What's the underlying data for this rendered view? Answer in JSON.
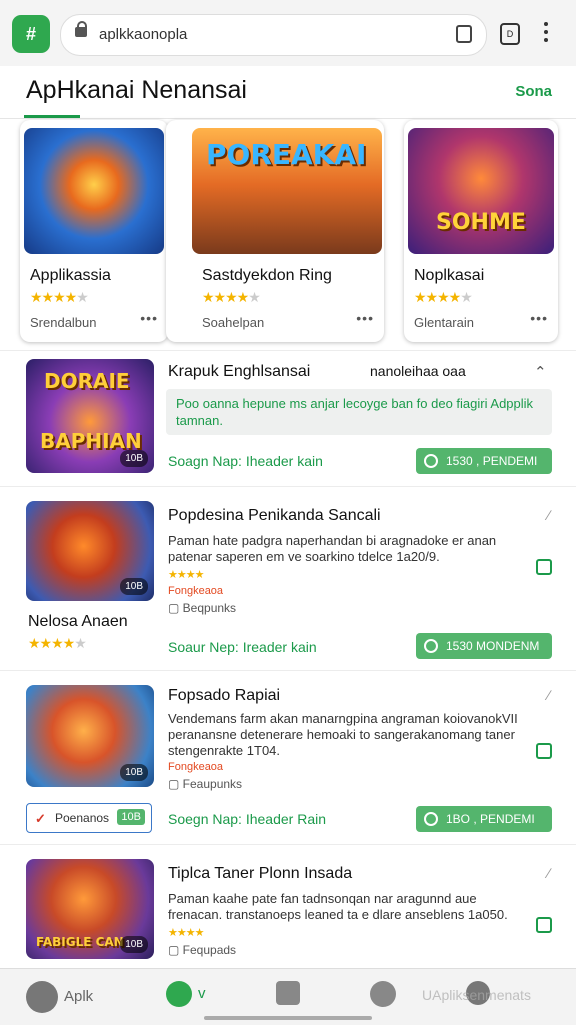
{
  "browser": {
    "logo_text": "#",
    "url": "aplkkaonopla",
    "tab_count": "D"
  },
  "header": {
    "title": "ApHkanai Nenansai",
    "action": "Sona"
  },
  "cards": [
    {
      "name": "Applikassia",
      "rating": 4,
      "sub": "Srendalbun",
      "more": "•••",
      "art_text": ""
    },
    {
      "name": "Sastdyekdon Ring",
      "rating": 4,
      "sub": "Soahelpan",
      "more": "•••",
      "art_text": "POREAKAI"
    },
    {
      "name": "Noplkasai",
      "rating": 4,
      "sub": "Glentarain",
      "more": "•••",
      "art_text": "SOHME"
    }
  ],
  "featured": {
    "title": "Krapuk Enghlsansai",
    "subtitle": "nanoleihaa oaa",
    "info_text": "Poo oanna hepune ms anjar lecoyge ban fo deo fiagiri Adpplik tamnan.",
    "art_top": "DORAIE",
    "art_bottom": "BAPHIAN",
    "price": "10B",
    "link": "Soagn Nap:  Iheader kain",
    "button": "1530 , PENDEMI"
  },
  "rows": [
    {
      "title": "Popdesina Penikanda Sancali",
      "desc": "Paman hate padgra naperhandan bi aragnadoke er anan patenar saperen em ve soarkino tdelce 1a20/9.",
      "stars": "★★★★",
      "tag": "Fongkeaoa",
      "meta": "Beqpunks",
      "price": "10B",
      "name_below": "Nelosa Anaen",
      "rating": 4,
      "link": "Soaur Nep:  Ireader kain",
      "button": "1530   MONDENM"
    },
    {
      "title": "Fopsado Rapiai",
      "desc": "Vendemans farm akan manarngpina angraman koiovanokVII peranansne detenerare hemoaki to sangerakanomang taner stengenrakte 1T04.",
      "stars": "",
      "tag": "Fongkeaoa",
      "meta": "Feaupunks",
      "price": "10B",
      "chip_label": "Poenanos",
      "chip_price": "10B",
      "link": "Soegn Nap:  Iheader Rain",
      "button": "1BO , PENDEMI"
    },
    {
      "title": "Tiplca Taner Plonn Insada",
      "desc": "Paman kaahe pate fan tadnsonqan nar aragunnd aue frenacan. transtanoeps leaned ta e dlare anseblens 1a050.",
      "stars": "★★★★",
      "tag": "",
      "meta": "Fequpads",
      "price": "10B",
      "art_text": "FABIGLE CAN"
    }
  ],
  "nav": {
    "home": "Aplk",
    "updates": "v",
    "apps": "",
    "messages": "",
    "settings": "UApliksenmenats"
  }
}
